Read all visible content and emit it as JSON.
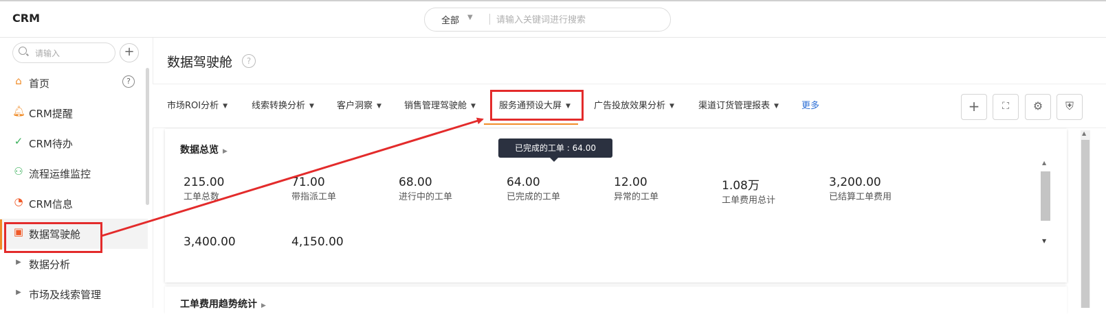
{
  "app": {
    "title": "CRM"
  },
  "search": {
    "scope": "全部",
    "placeholder": "请输入关键词进行搜索"
  },
  "sidebar": {
    "search_placeholder": "请输入",
    "items": [
      {
        "label": "首页",
        "icon": "home-icon",
        "color": "#f08c28"
      },
      {
        "label": "CRM提醒",
        "icon": "bell-icon",
        "color": "#f08c28"
      },
      {
        "label": "CRM待办",
        "icon": "check-circle-icon",
        "color": "#3bb05b"
      },
      {
        "label": "流程运维监控",
        "icon": "flow-tree-icon",
        "color": "#3bb05b"
      },
      {
        "label": "CRM信息",
        "icon": "clock-icon",
        "color": "#f05a28"
      },
      {
        "label": "数据驾驶舱",
        "icon": "dashboard-icon",
        "color": "#f05a28"
      },
      {
        "label": "数据分析",
        "icon": "caret-right-icon",
        "color": "#777777"
      },
      {
        "label": "市场及线索管理",
        "icon": "caret-right-icon",
        "color": "#777777"
      }
    ]
  },
  "page": {
    "title": "数据驾驶舱"
  },
  "tabs": [
    {
      "label": "市场ROI分析"
    },
    {
      "label": "线索转换分析"
    },
    {
      "label": "客户洞察"
    },
    {
      "label": "销售管理驾驶舱"
    },
    {
      "label": "服务通预设大屏"
    },
    {
      "label": "广告投放效果分析"
    },
    {
      "label": "渠道订货管理报表"
    }
  ],
  "tabs_more": "更多",
  "tooltip": "已完成的工单 : 64.00",
  "overview": {
    "title": "数据总览",
    "metrics": [
      {
        "value": "215.00",
        "label": "工单总数"
      },
      {
        "value": "71.00",
        "label": "带指派工单"
      },
      {
        "value": "68.00",
        "label": "进行中的工单"
      },
      {
        "value": "64.00",
        "label": "已完成的工单"
      },
      {
        "value": "12.00",
        "label": "异常的工单"
      },
      {
        "value": "1.08万",
        "label": "工单费用总计"
      },
      {
        "value": "3,200.00",
        "label": "已结算工单费用"
      },
      {
        "value": "3,400.00",
        "label": ""
      },
      {
        "value": "4,150.00",
        "label": ""
      }
    ]
  },
  "section2": {
    "title": "工单费用趋势统计"
  },
  "colors": {
    "accent": "#f08c28",
    "highlight": "#e32b2b",
    "link": "#2d6fd6",
    "tooltip_bg": "#2b3140"
  }
}
